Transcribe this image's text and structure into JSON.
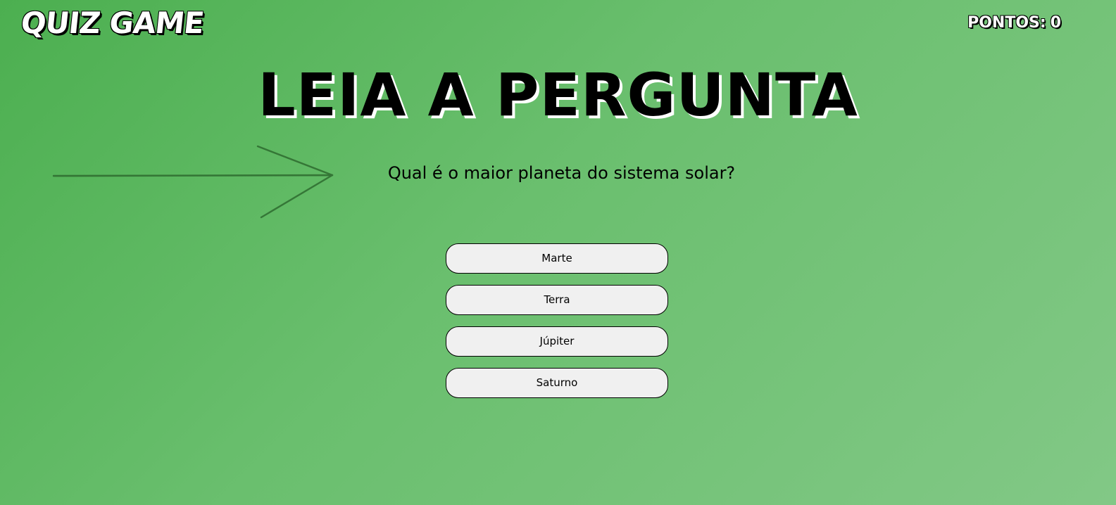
{
  "header": {
    "logo_text": "QUIZ GAME",
    "score_label": "PONTOS:",
    "score_value": "0"
  },
  "main": {
    "headline": "LEIA A PERGUNTA",
    "question": "Qual é o maior planeta do sistema solar?",
    "answers": [
      {
        "label": "Marte"
      },
      {
        "label": "Terra"
      },
      {
        "label": "Júpiter"
      },
      {
        "label": "Saturno"
      }
    ]
  },
  "decor": {
    "arrow_icon": "arrow-right-icon",
    "arrow_color": "#2e6b2f"
  },
  "colors": {
    "background_start": "#4caf50",
    "background_end": "#82c886",
    "button_fill": "#f0f0f0",
    "text": "#000000"
  }
}
